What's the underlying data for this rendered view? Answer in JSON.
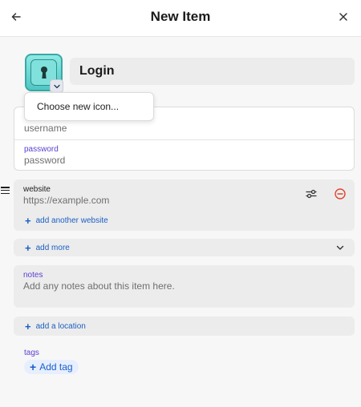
{
  "header": {
    "title": "New Item",
    "back_icon": "arrow-left-icon",
    "close_icon": "close-icon"
  },
  "item": {
    "icon": "keyhole-icon",
    "icon_colors": {
      "tile": "#4fc7c3",
      "border": "#3aa8a6"
    },
    "title": "Login",
    "icon_menu": {
      "option": "Choose new icon..."
    }
  },
  "credentials": {
    "username_placeholder": "username",
    "password_label": "password",
    "password_placeholder": "password"
  },
  "website": {
    "label": "website",
    "placeholder": "https://example.com",
    "add_another": "add another website"
  },
  "sections": {
    "add_more": "add more",
    "notes_label": "notes",
    "notes_placeholder": "Add any notes about this item here.",
    "add_location": "add a location"
  },
  "tags": {
    "label": "tags",
    "add": "Add tag"
  },
  "colors": {
    "accent_label": "#5b3fd1",
    "link": "#1a5fc4",
    "remove": "#e0442f"
  }
}
